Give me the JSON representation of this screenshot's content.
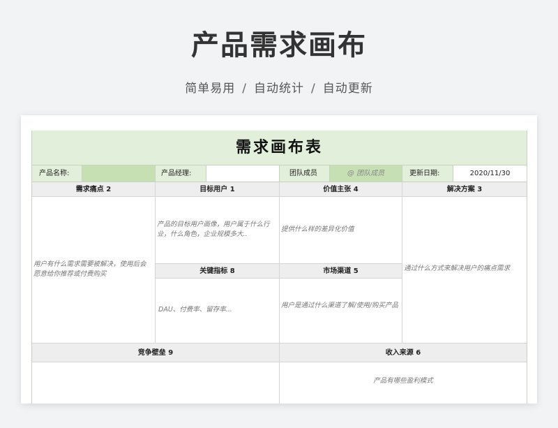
{
  "header": {
    "title": "产品需求画布",
    "subtitle_parts": [
      "简单易用",
      "自动统计",
      "自动更新"
    ],
    "separator": "/"
  },
  "sheet": {
    "title": "需求画布表",
    "info": {
      "product_name_label": "产品名称:",
      "product_name_value": "",
      "manager_label": "产品经理:",
      "manager_value": "",
      "team_label": "团队成员",
      "team_placeholder": "@ 团队成员",
      "update_label": "更新日期:",
      "update_value": "2020/11/30"
    },
    "sections": {
      "pain_points": {
        "title": "需求痛点 2",
        "desc": "用户有什么需求需要被解决，使用后会愿意给你推荐或付费购买"
      },
      "target_users": {
        "title": "目标用户 1",
        "desc": "产品的目标用户画像，用户属于什么行业，什么角色，企业规模多大.."
      },
      "value_prop": {
        "title": "价值主张 4",
        "desc": "提供什么样的差异化价值"
      },
      "solution": {
        "title": "解决方案 3",
        "desc": "通过什么方式来解决用户的痛点需求"
      },
      "key_metrics": {
        "title": "关键指标 8",
        "desc": "DAU、付费率、留存率..."
      },
      "channels": {
        "title": "市场渠道 5",
        "desc": "用户是通过什么渠道了解/使用/购买产品"
      },
      "competition": {
        "title": "竞争壁垒 9",
        "desc": ""
      },
      "revenue": {
        "title": "收入来源 6",
        "desc": "产品有哪些盈利模式"
      }
    }
  }
}
